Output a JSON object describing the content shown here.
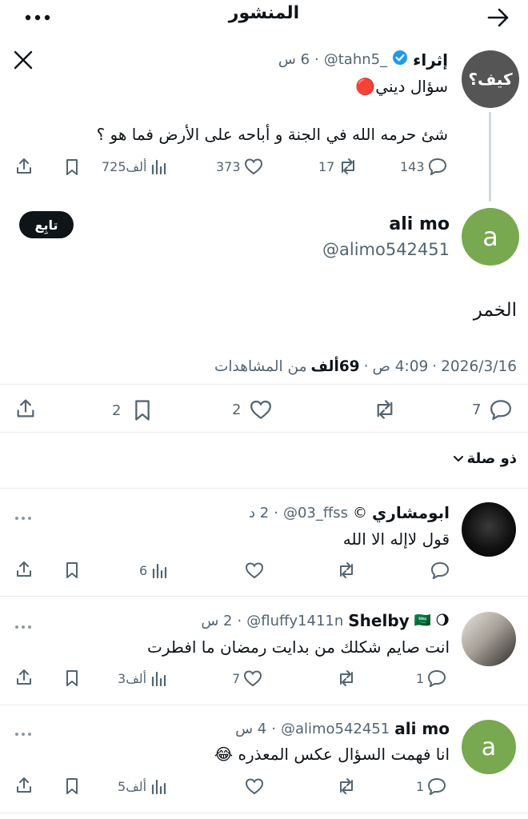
{
  "header": {
    "title": "المنشور"
  },
  "quoted": {
    "avatar_text": "كيف؟",
    "name": "إثراء",
    "handle": "@tahn5_",
    "time": "6 س",
    "line1": "سؤال ديني",
    "line1_emoji": "🔴",
    "text": "شئ حرمه الله في الجنة و أباحه على الأرض فما هو ؟",
    "replies": "143",
    "reposts": "17",
    "likes": "373",
    "views": "725ألف"
  },
  "main": {
    "avatar_letter": "a",
    "name": "ali mo",
    "handle": "@alimo542451",
    "follow_label": "تابِع",
    "text": "الخمر",
    "date": "2026/3/16",
    "time": "4:09 ص",
    "views_count": "69ألف",
    "views_label": "من المشاهدات",
    "replies": "7",
    "likes": "2",
    "bookmarks": "2"
  },
  "relevance_label": "ذو صلة",
  "replies": [
    {
      "name": "ابومشاري",
      "badge": "©",
      "handle": "@03_ffss",
      "time": "2 د",
      "text": "قول لاإله الا الله",
      "replies": "",
      "reposts": "",
      "likes": "",
      "views": "6"
    },
    {
      "name": "Shelby",
      "badge": "🌖 🇸🇦",
      "handle": "@fluffy1411n",
      "time": "2 س",
      "text": "انت صايم شكلك من بدايت رمضان ما افطرت",
      "replies": "1",
      "reposts": "",
      "likes": "7",
      "views": "3ألف"
    },
    {
      "name": "ali mo",
      "avatar_letter": "a",
      "handle": "@alimo542451",
      "time": "4 س",
      "text": "انا فهمت السؤال عكس المعذره",
      "text_emoji": "😂",
      "replies": "1",
      "reposts": "",
      "likes": "",
      "views": "5ألف"
    }
  ],
  "colors": {
    "accent": "#1d9bf0",
    "green_avatar": "#78a84f",
    "text": "#0f1419",
    "muted": "#536471"
  }
}
